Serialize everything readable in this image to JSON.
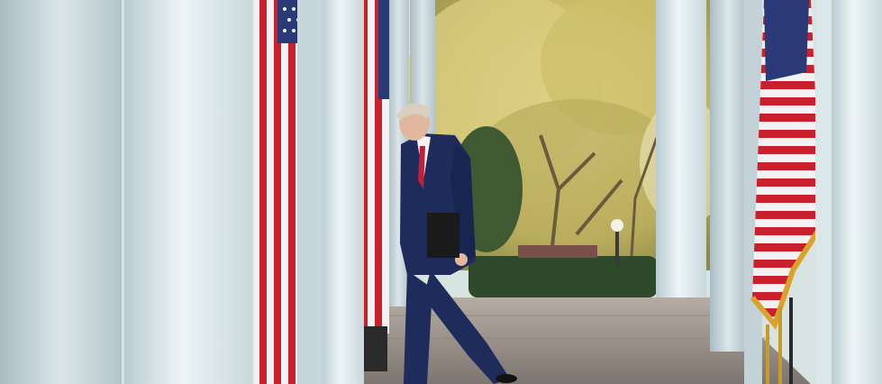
{
  "scene": {
    "kind": "photograph",
    "colors": {
      "column": "#dfe9ec",
      "column_shade": "#b9cbd1",
      "column_light": "#eef5f6",
      "flag_red": "#c9202e",
      "flag_white": "#f2f2f2",
      "flag_blue": "#2a3a78",
      "fringe_gold": "#d9a22a",
      "foliage": "#c9b866",
      "foliage_light": "#e8df9d",
      "hedge": "#2f4a2a",
      "suit": "#1d2c5b",
      "tie": "#c21f3a",
      "floor": "#9a9189",
      "floor_dark": "#7d756f"
    },
    "elements": [
      "colonnade-columns",
      "american-flags",
      "autumn-trees",
      "boxwood-hedge",
      "man-in-suit",
      "black-folder",
      "stone-walkway",
      "lamp-post"
    ]
  }
}
